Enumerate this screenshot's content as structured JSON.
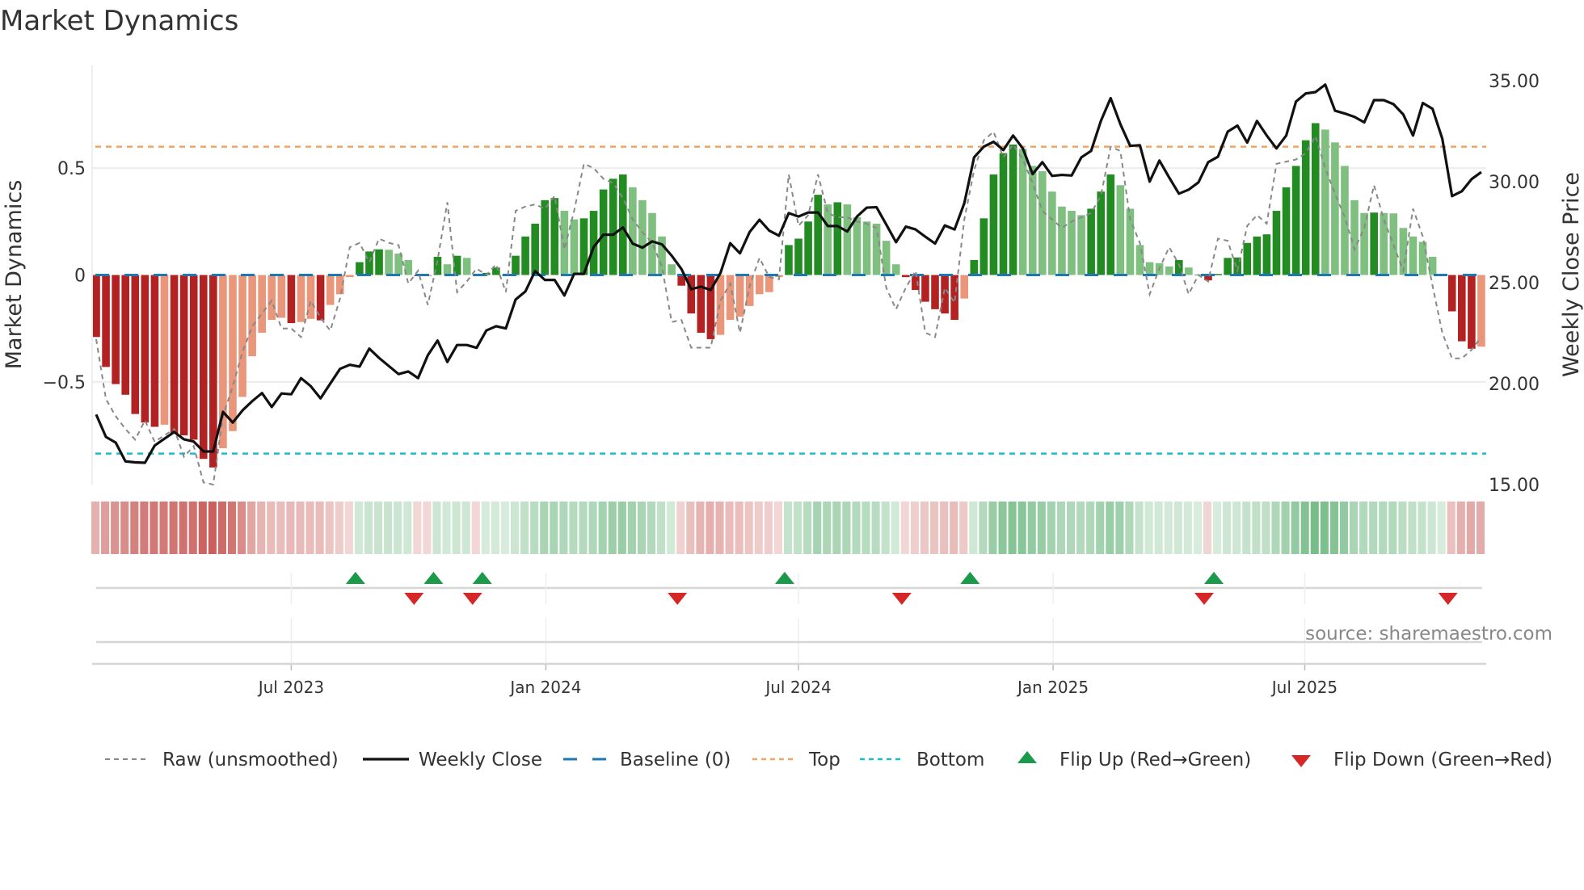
{
  "title": "Market Dynamics",
  "source": "source: sharemaestro.com",
  "legend": [
    {
      "key": "raw",
      "label": "Raw (unsmoothed)"
    },
    {
      "key": "close",
      "label": "Weekly Close"
    },
    {
      "key": "baseline",
      "label": "Baseline (0)"
    },
    {
      "key": "top",
      "label": "Top"
    },
    {
      "key": "bottom",
      "label": "Bottom"
    },
    {
      "key": "flip_up",
      "label": "Flip Up (Red→Green)"
    },
    {
      "key": "flip_down",
      "label": "Flip Down (Green→Red)"
    }
  ],
  "colors": {
    "strong_neg": "#b22222",
    "weak_neg": "#e9967a",
    "strong_pos": "#228b22",
    "weak_pos": "#7fbf7f",
    "raw": "#888888",
    "close": "#111111",
    "baseline": "#1f77b4",
    "top": "#f4a460",
    "bottom": "#17becf",
    "flip_up": "#1a9a4a",
    "flip_down": "#d62728"
  },
  "chart_data": {
    "type": "bar",
    "title": "Market Dynamics",
    "ylabel": "Market Dynamics",
    "y2label": "Weekly Close Price",
    "xlabel": "",
    "ylim": [
      -0.98,
      0.98
    ],
    "y2lim": [
      15,
      35.75
    ],
    "yticks": [
      {
        "v": 0.5,
        "label": "0.5"
      },
      {
        "v": 0,
        "label": "0"
      },
      {
        "v": -0.5,
        "label": "−0.5"
      }
    ],
    "y2ticks": [
      {
        "v": 35,
        "label": "35.00"
      },
      {
        "v": 30,
        "label": "30.00"
      },
      {
        "v": 25,
        "label": "25.00"
      },
      {
        "v": 20,
        "label": "20.00"
      },
      {
        "v": 15,
        "label": "15.00"
      }
    ],
    "x_unit": "week index",
    "xticks": [
      {
        "week": 20.0,
        "label": "Jul 2023"
      },
      {
        "week": 46.1,
        "label": "Jan 2024"
      },
      {
        "week": 72.0,
        "label": "Jul 2024"
      },
      {
        "week": 98.1,
        "label": "Jan 2025"
      },
      {
        "week": 123.9,
        "label": "Jul 2025"
      }
    ],
    "baseline": 0,
    "top": 0.6,
    "bottom": -0.835,
    "smoothed": [
      -0.29,
      -0.43,
      -0.51,
      -0.56,
      -0.65,
      -0.69,
      -0.71,
      -0.7,
      -0.74,
      -0.75,
      -0.77,
      -0.86,
      -0.9,
      -0.81,
      -0.73,
      -0.57,
      -0.38,
      -0.27,
      -0.21,
      -0.2,
      -0.225,
      -0.22,
      -0.205,
      -0.212,
      -0.14,
      -0.09,
      -0.01,
      0.06,
      0.11,
      0.12,
      0.118,
      0.1,
      0.07,
      -0.005,
      -0.003,
      0.085,
      0.05,
      0.09,
      0.08,
      -0.005,
      0.01,
      0.035,
      0.002,
      0.09,
      0.18,
      0.24,
      0.35,
      0.36,
      0.3,
      0.26,
      0.265,
      0.3,
      0.4,
      0.45,
      0.47,
      0.41,
      0.35,
      0.29,
      0.18,
      0.05,
      -0.05,
      -0.18,
      -0.27,
      -0.3,
      -0.28,
      -0.21,
      -0.195,
      -0.145,
      -0.09,
      -0.08,
      -0.01,
      0.14,
      0.17,
      0.25,
      0.375,
      0.33,
      0.34,
      0.33,
      0.27,
      0.25,
      0.24,
      0.16,
      0.05,
      -0.01,
      -0.07,
      -0.125,
      -0.16,
      -0.18,
      -0.21,
      -0.11,
      0.07,
      0.265,
      0.47,
      0.57,
      0.61,
      0.59,
      0.51,
      0.485,
      0.39,
      0.32,
      0.3,
      0.28,
      0.31,
      0.39,
      0.47,
      0.42,
      0.31,
      0.14,
      0.06,
      0.055,
      0.04,
      0.07,
      0.035,
      0.003,
      -0.025,
      0.005,
      0.08,
      0.082,
      0.15,
      0.18,
      0.19,
      0.3,
      0.41,
      0.51,
      0.63,
      0.71,
      0.68,
      0.62,
      0.51,
      0.35,
      0.29,
      0.292,
      0.29,
      0.288,
      0.22,
      0.18,
      0.155,
      0.085,
      0.002,
      -0.17,
      -0.31,
      -0.345,
      -0.335
    ],
    "raw": [
      -0.3,
      -0.58,
      -0.66,
      -0.72,
      -0.77,
      -0.68,
      -0.78,
      -0.75,
      -0.72,
      -0.85,
      -0.8,
      -0.97,
      -0.98,
      -0.66,
      -0.52,
      -0.36,
      -0.24,
      -0.18,
      -0.12,
      -0.25,
      -0.25,
      -0.29,
      -0.12,
      -0.2,
      -0.26,
      -0.11,
      0.13,
      0.15,
      0.06,
      0.17,
      0.15,
      0.14,
      -0.04,
      0.02,
      -0.14,
      0.07,
      0.34,
      -0.08,
      -0.03,
      0.03,
      0.0,
      0.05,
      -0.08,
      0.3,
      0.32,
      0.33,
      0.31,
      0.37,
      0.12,
      0.3,
      0.52,
      0.5,
      0.45,
      0.43,
      0.36,
      0.26,
      0.2,
      0.15,
      0.04,
      -0.22,
      -0.21,
      -0.34,
      -0.34,
      -0.34,
      -0.12,
      -0.04,
      -0.27,
      -0.05,
      0.08,
      -0.01,
      -0.02,
      0.47,
      0.23,
      0.28,
      0.47,
      0.29,
      0.27,
      0.27,
      0.25,
      0.24,
      0.22,
      -0.06,
      -0.16,
      -0.06,
      0.02,
      -0.27,
      -0.29,
      -0.06,
      -0.13,
      0.26,
      0.49,
      0.63,
      0.67,
      0.55,
      0.61,
      0.54,
      0.43,
      0.3,
      0.26,
      0.22,
      0.25,
      0.27,
      0.29,
      0.37,
      0.6,
      0.58,
      0.26,
      0.15,
      -0.09,
      0.03,
      0.13,
      0.05,
      -0.09,
      0.0,
      -0.03,
      0.17,
      0.16,
      0.02,
      0.23,
      0.28,
      0.24,
      0.52,
      0.53,
      0.54,
      0.57,
      0.65,
      0.5,
      0.38,
      0.27,
      0.12,
      0.22,
      0.42,
      0.26,
      0.14,
      0.02,
      0.31,
      0.18,
      -0.05,
      -0.27,
      -0.39,
      -0.39,
      -0.35,
      -0.29
    ],
    "close": [
      18.47,
      17.36,
      17.08,
      16.15,
      16.1,
      16.08,
      16.93,
      17.27,
      17.6,
      17.24,
      17.13,
      16.64,
      16.64,
      18.6,
      18.07,
      18.67,
      19.13,
      19.53,
      18.84,
      19.51,
      19.47,
      20.27,
      19.87,
      19.27,
      20.0,
      20.73,
      20.93,
      20.84,
      21.73,
      21.27,
      20.87,
      20.47,
      20.6,
      20.27,
      21.4,
      22.13,
      21.07,
      21.91,
      21.91,
      21.77,
      22.63,
      22.84,
      22.73,
      24.16,
      24.56,
      25.57,
      25.13,
      25.13,
      24.36,
      25.43,
      25.43,
      26.76,
      27.37,
      27.37,
      27.73,
      26.93,
      26.73,
      27.04,
      26.89,
      26.33,
      25.67,
      24.67,
      24.8,
      24.63,
      25.47,
      26.95,
      26.45,
      27.51,
      28.11,
      27.57,
      27.32,
      28.44,
      28.27,
      28.47,
      28.47,
      27.8,
      27.8,
      27.53,
      28.27,
      28.71,
      28.73,
      27.87,
      27.0,
      27.77,
      27.63,
      27.27,
      26.93,
      27.83,
      27.63,
      28.93,
      31.2,
      31.73,
      31.97,
      31.56,
      32.28,
      31.64,
      30.37,
      30.96,
      30.28,
      30.33,
      30.3,
      31.2,
      31.52,
      33.0,
      34.13,
      32.84,
      31.77,
      31.8,
      30.0,
      31.04,
      30.2,
      29.4,
      29.6,
      29.96,
      30.96,
      31.23,
      32.47,
      32.77,
      31.93,
      33.0,
      32.28,
      31.64,
      32.28,
      33.96,
      34.36,
      34.43,
      34.8,
      33.51,
      33.37,
      33.2,
      32.93,
      34.03,
      34.03,
      33.83,
      33.32,
      32.28,
      33.89,
      33.6,
      32.12,
      29.28,
      29.52,
      30.12,
      30.47
    ],
    "flip_up": [
      27,
      35,
      40,
      71,
      90,
      115
    ],
    "flip_down": [
      33,
      39,
      60,
      83,
      114,
      139
    ],
    "grid": true,
    "legend_position": "bottom"
  }
}
